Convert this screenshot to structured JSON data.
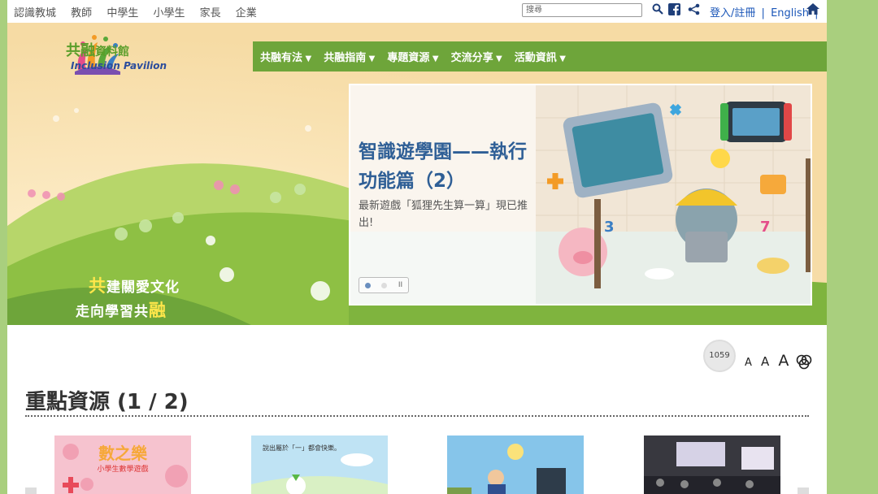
{
  "top": {
    "audiences": [
      "認識教城",
      "教師",
      "中學生",
      "小學生",
      "家長",
      "企業"
    ],
    "search_placeholder": "搜尋",
    "login": "登入/註冊",
    "english": "English",
    "sep": "|"
  },
  "logo": {
    "cn_main": "共融",
    "cn_sub": "資料館",
    "en": "Inclusion Pavilion"
  },
  "nav": [
    "共融有法",
    "共融指南",
    "專題資源",
    "交流分享",
    "活動資訊"
  ],
  "slogan": {
    "line1_hl": "共",
    "line1": "建關愛文化",
    "line2": "走向學習共",
    "line2_hl": "融"
  },
  "slide": {
    "title": "智識遊學園——執行功能篇（2）",
    "desc": "最新遊戲「狐狸先生算一算」現已推出!",
    "pause": "II"
  },
  "counter": "1059",
  "font_sizes": [
    "A",
    "A",
    "A"
  ],
  "section": {
    "title": "重點資源 (1 / 2)"
  },
  "cards": [
    {
      "title": "數之樂",
      "subtitle": "小學生數學遊戲"
    },
    {
      "title": "說出屬於「一」都會快樂。"
    },
    {
      "title": ""
    },
    {
      "title": ""
    }
  ],
  "colors": {
    "green_nav": "#6ea53a",
    "side_green": "#a9cf7e",
    "title_blue": "#2f5f96"
  }
}
